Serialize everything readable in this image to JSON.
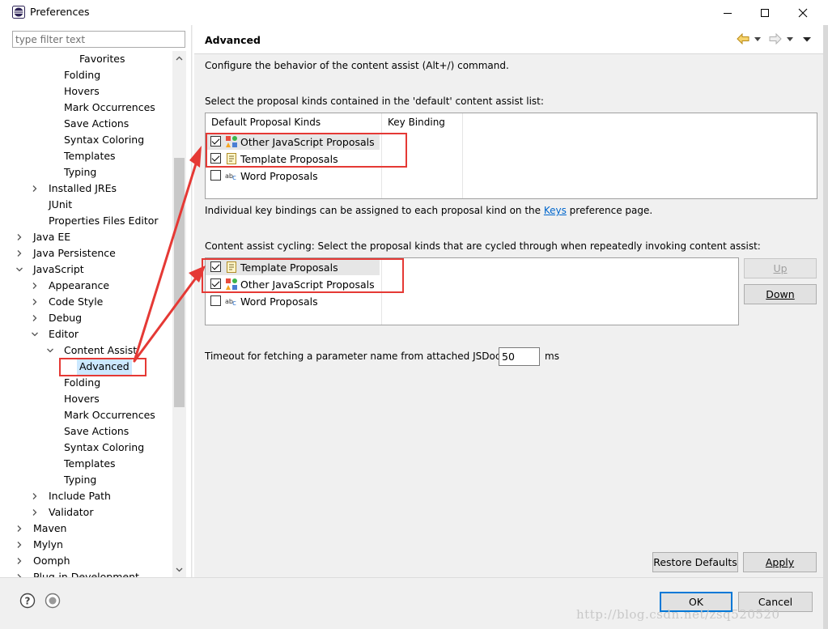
{
  "window": {
    "title": "Preferences"
  },
  "filter": {
    "placeholder": "type filter text"
  },
  "tree": [
    {
      "label": "Favorites",
      "indent": 4,
      "chevron": "none"
    },
    {
      "label": "Folding",
      "indent": 3,
      "chevron": "none"
    },
    {
      "label": "Hovers",
      "indent": 3,
      "chevron": "none"
    },
    {
      "label": "Mark Occurrences",
      "indent": 3,
      "chevron": "none"
    },
    {
      "label": "Save Actions",
      "indent": 3,
      "chevron": "none"
    },
    {
      "label": "Syntax Coloring",
      "indent": 3,
      "chevron": "none"
    },
    {
      "label": "Templates",
      "indent": 3,
      "chevron": "none"
    },
    {
      "label": "Typing",
      "indent": 3,
      "chevron": "none"
    },
    {
      "label": "Installed JREs",
      "indent": 2,
      "chevron": "right"
    },
    {
      "label": "JUnit",
      "indent": 2,
      "chevron": "none"
    },
    {
      "label": "Properties Files Editor",
      "indent": 2,
      "chevron": "none"
    },
    {
      "label": "Java EE",
      "indent": 1,
      "chevron": "right"
    },
    {
      "label": "Java Persistence",
      "indent": 1,
      "chevron": "right"
    },
    {
      "label": "JavaScript",
      "indent": 1,
      "chevron": "down"
    },
    {
      "label": "Appearance",
      "indent": 2,
      "chevron": "right"
    },
    {
      "label": "Code Style",
      "indent": 2,
      "chevron": "right"
    },
    {
      "label": "Debug",
      "indent": 2,
      "chevron": "right"
    },
    {
      "label": "Editor",
      "indent": 2,
      "chevron": "down"
    },
    {
      "label": "Content Assist",
      "indent": 3,
      "chevron": "down"
    },
    {
      "label": "Advanced",
      "indent": 4,
      "chevron": "none",
      "selected": true
    },
    {
      "label": "Folding",
      "indent": 3,
      "chevron": "none"
    },
    {
      "label": "Hovers",
      "indent": 3,
      "chevron": "none"
    },
    {
      "label": "Mark Occurrences",
      "indent": 3,
      "chevron": "none"
    },
    {
      "label": "Save Actions",
      "indent": 3,
      "chevron": "none"
    },
    {
      "label": "Syntax Coloring",
      "indent": 3,
      "chevron": "none"
    },
    {
      "label": "Templates",
      "indent": 3,
      "chevron": "none"
    },
    {
      "label": "Typing",
      "indent": 3,
      "chevron": "none"
    },
    {
      "label": "Include Path",
      "indent": 2,
      "chevron": "right"
    },
    {
      "label": "Validator",
      "indent": 2,
      "chevron": "right"
    },
    {
      "label": "Maven",
      "indent": 1,
      "chevron": "right"
    },
    {
      "label": "Mylyn",
      "indent": 1,
      "chevron": "right"
    },
    {
      "label": "Oomph",
      "indent": 1,
      "chevron": "right"
    },
    {
      "label": "Plug-in Development",
      "indent": 1,
      "chevron": "right"
    }
  ],
  "page": {
    "title": "Advanced",
    "description": "Configure the behavior of the content assist (Alt+/) command.",
    "default_list_label": "Select the proposal kinds contained in the 'default' content assist list:",
    "table_headers": [
      "Default Proposal Kinds",
      "Key Binding"
    ],
    "default_kinds": [
      {
        "label": "Other JavaScript Proposals",
        "checked": true,
        "icon": "js-proposals-icon",
        "selected": true
      },
      {
        "label": "Template Proposals",
        "checked": true,
        "icon": "template-icon",
        "selected": false
      },
      {
        "label": "Word Proposals",
        "checked": false,
        "icon": "word-icon",
        "selected": false
      }
    ],
    "keys_text_before": "Individual key bindings can be assigned to each proposal kind on the ",
    "keys_link": "Keys",
    "keys_text_after": " preference page.",
    "cycling_label": "Content assist cycling: Select the proposal kinds that are cycled through when repeatedly invoking content assist:",
    "cycling_kinds": [
      {
        "label": "Template Proposals",
        "checked": true,
        "icon": "template-icon",
        "selected": true
      },
      {
        "label": "Other JavaScript Proposals",
        "checked": true,
        "icon": "js-proposals-icon",
        "selected": false
      },
      {
        "label": "Word Proposals",
        "checked": false,
        "icon": "word-icon",
        "selected": false
      }
    ],
    "up_button": "Up",
    "down_button": "Down",
    "timeout_label": "Timeout for fetching a parameter name from attached JSDoc:",
    "timeout_value": "50",
    "timeout_unit": "ms",
    "restore_defaults": "Restore Defaults",
    "apply": "Apply"
  },
  "footer": {
    "ok": "OK",
    "cancel": "Cancel"
  },
  "watermark": "http://blog.csdn.net/zsq520520",
  "colors": {
    "annotation_red": "#e53935",
    "selection_blue": "#cce8ff",
    "focus_blue": "#0078d7"
  }
}
